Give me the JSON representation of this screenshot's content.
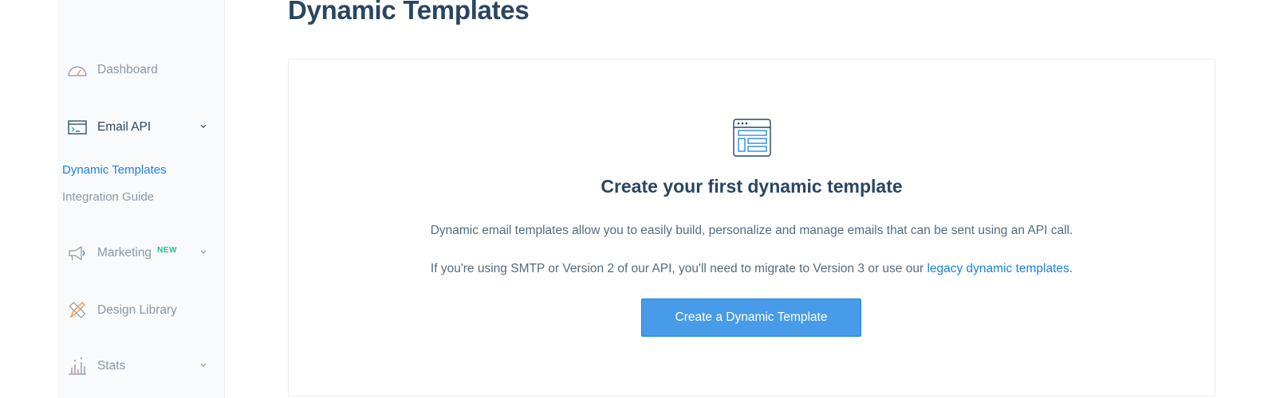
{
  "page": {
    "title": "Dynamic Templates"
  },
  "sidebar": {
    "dashboard": {
      "label": "Dashboard",
      "icon": "dashboard-gauge-icon"
    },
    "email_api": {
      "label": "Email API",
      "icon": "terminal-window-icon"
    },
    "email_api_children": [
      {
        "label": "Dynamic Templates",
        "active": true
      },
      {
        "label": "Integration Guide",
        "active": false
      }
    ],
    "marketing": {
      "label": "Marketing",
      "badge": "NEW",
      "icon": "megaphone-icon"
    },
    "design_library": {
      "label": "Design Library",
      "icon": "pencil-ruler-icon"
    },
    "stats": {
      "label": "Stats",
      "icon": "bar-stats-icon"
    }
  },
  "empty_state": {
    "icon": "template-layout-icon",
    "heading": "Create your first dynamic template",
    "description": "Dynamic email templates allow you to easily build, personalize and manage emails that can be sent using an API call.",
    "note_before": "If you're using SMTP or Version 2 of our API, you'll need to migrate to Version 3 or use our ",
    "note_link": "legacy dynamic templates",
    "note_after": ".",
    "button_label": "Create a Dynamic Template"
  },
  "colors": {
    "accent": "#1a82e2",
    "button_bg": "#489be8",
    "heading": "#294661",
    "muted": "#8c98a4",
    "badge": "#1bbf8a"
  }
}
